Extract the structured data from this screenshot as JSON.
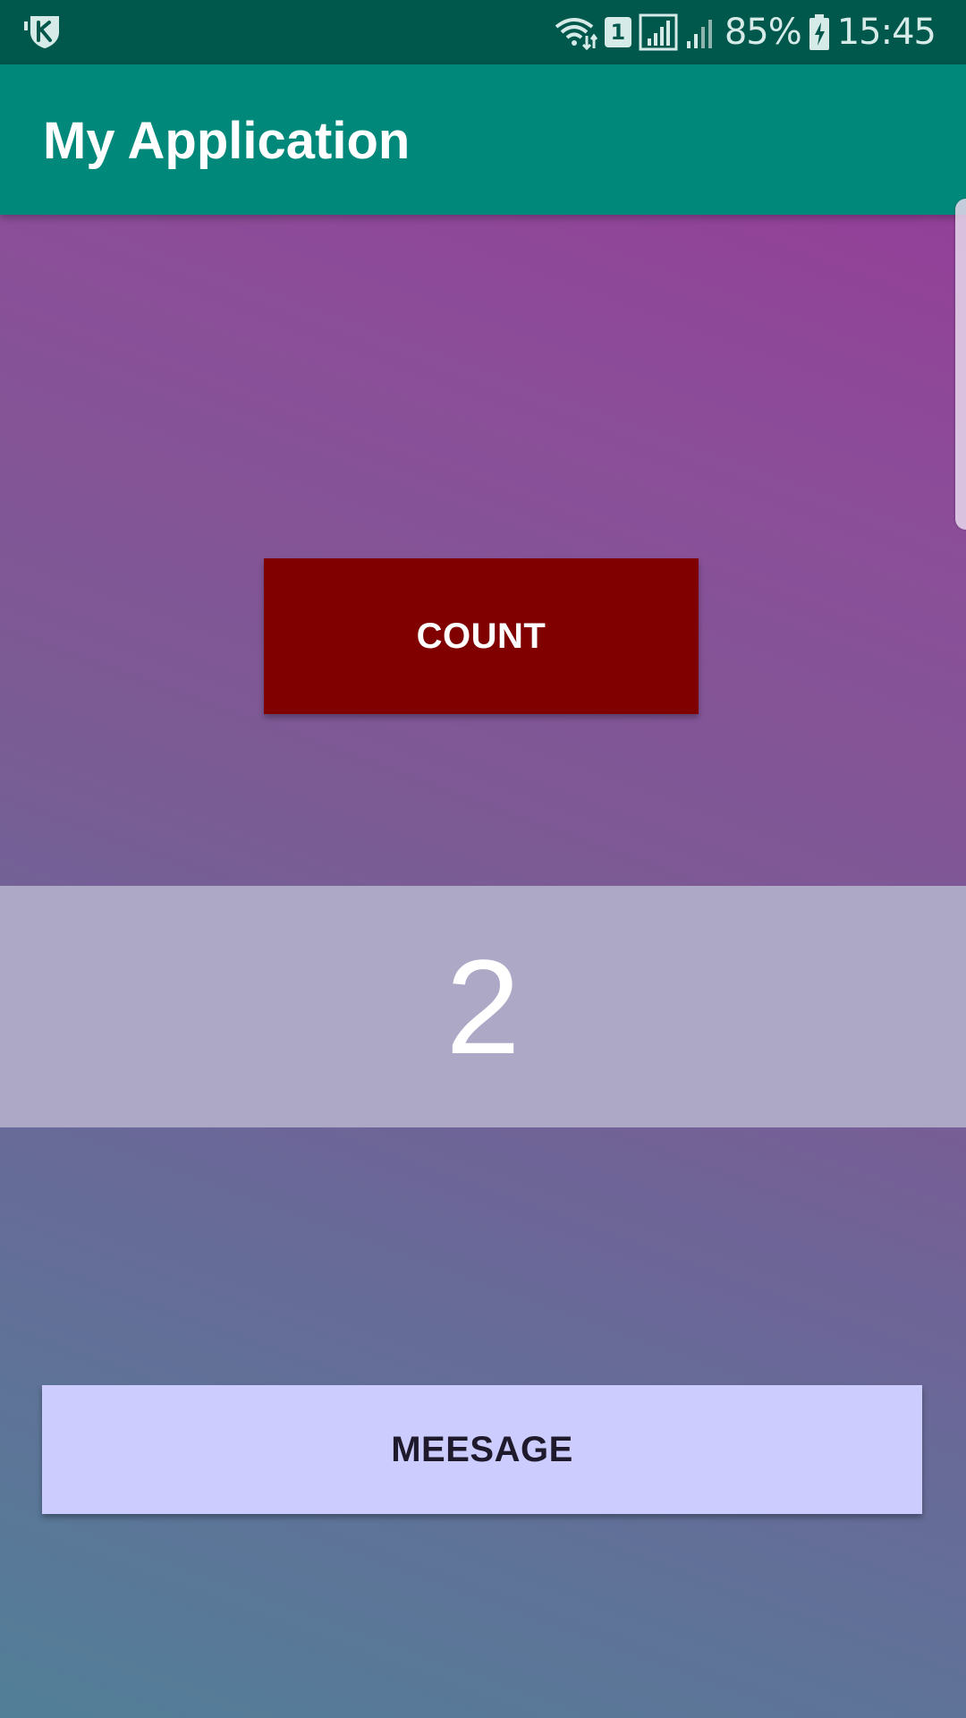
{
  "status_bar": {
    "left_icon": "k-shield-icon",
    "icons": [
      "wifi-data-icon",
      "sim-1-icon",
      "signal-full-icon",
      "signal-partial-icon"
    ],
    "sim_label": "1",
    "battery_percent": "85%",
    "battery_icon": "battery-charging-icon",
    "time": "15:45",
    "color": "#00574b"
  },
  "app_bar": {
    "title": "My Application",
    "color": "#00897b"
  },
  "main": {
    "count_button_label": "COUNT",
    "count_button_color": "#800000",
    "count_value": "2",
    "message_button_label": "MEESAGE",
    "message_button_color": "#ccccff"
  }
}
